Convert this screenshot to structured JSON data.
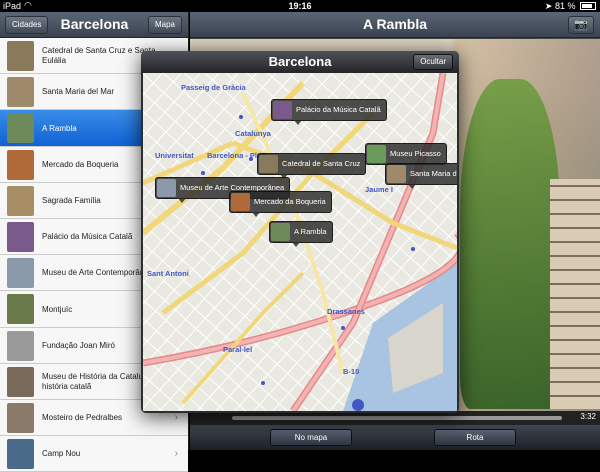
{
  "status": {
    "carrier": "iPad",
    "time": "19:16",
    "battery": "81 %",
    "battery_level": 0.81
  },
  "sidebar": {
    "back_label": "Cidades",
    "title": "Barcelona",
    "map_label": "Mapa",
    "items": [
      {
        "label": "Catedral de Santa Cruz e Santa Eulália",
        "thumb": "#8a7a5c"
      },
      {
        "label": "Santa Maria del Mar",
        "thumb": "#9e8a6a"
      },
      {
        "label": "A Rambla",
        "thumb": "#6c8a5a",
        "selected": true
      },
      {
        "label": "Mercado da Boqueria",
        "thumb": "#b06a3a"
      },
      {
        "label": "Sagrada Família",
        "thumb": "#a88e64"
      },
      {
        "label": "Palácio da Música Catalã",
        "thumb": "#7a5a8a"
      },
      {
        "label": "Museu de Arte Contemporânea",
        "thumb": "#8a9aaa"
      },
      {
        "label": "Montjuïc",
        "thumb": "#6a7a4a"
      },
      {
        "label": "Fundação Joan Miró",
        "thumb": "#9a9a9a"
      },
      {
        "label": "Museu de História da Catalunha história catalã",
        "thumb": "#7a6a5a"
      },
      {
        "label": "Mosteiro de Pedralbes",
        "thumb": "#8a7a6a"
      },
      {
        "label": "Camp Nou",
        "thumb": "#4a6a8a"
      }
    ]
  },
  "main": {
    "title": "A Rambla",
    "video_time": "3:32",
    "map_button": "No mapa",
    "route_button": "Rota"
  },
  "popover": {
    "title": "Barcelona",
    "hide_label": "Ocultar",
    "map_labels": [
      {
        "text": "Passeig de Gràcia",
        "color": "blue"
      },
      {
        "text": "Catalunya",
        "color": "blue"
      },
      {
        "text": "Universitat",
        "color": "blue"
      },
      {
        "text": "Barcelona - Plaç",
        "color": "blue"
      },
      {
        "text": "Jaume I",
        "color": "blue"
      },
      {
        "text": "Sant Antoni",
        "color": "blue"
      },
      {
        "text": "Drassanes",
        "color": "blue"
      },
      {
        "text": "Paral-lel",
        "color": "blue"
      },
      {
        "text": "B-10",
        "color": "blue"
      }
    ],
    "pins": [
      {
        "label": "Palácio da Música Catalã",
        "thumb": "#7a5a8a"
      },
      {
        "label": "Museu Picasso",
        "thumb": "#6a9a5a"
      },
      {
        "label": "Catedral de Santa Cruz",
        "thumb": "#8a7a5c"
      },
      {
        "label": "Santa Maria del M",
        "thumb": "#9e8a6a"
      },
      {
        "label": "Museu de Arte Contemporânea",
        "thumb": "#8a9aaa"
      },
      {
        "label": "Mercado da Boqueria",
        "thumb": "#b06a3a"
      },
      {
        "label": "A Rambla",
        "thumb": "#6c8a5a"
      }
    ]
  }
}
